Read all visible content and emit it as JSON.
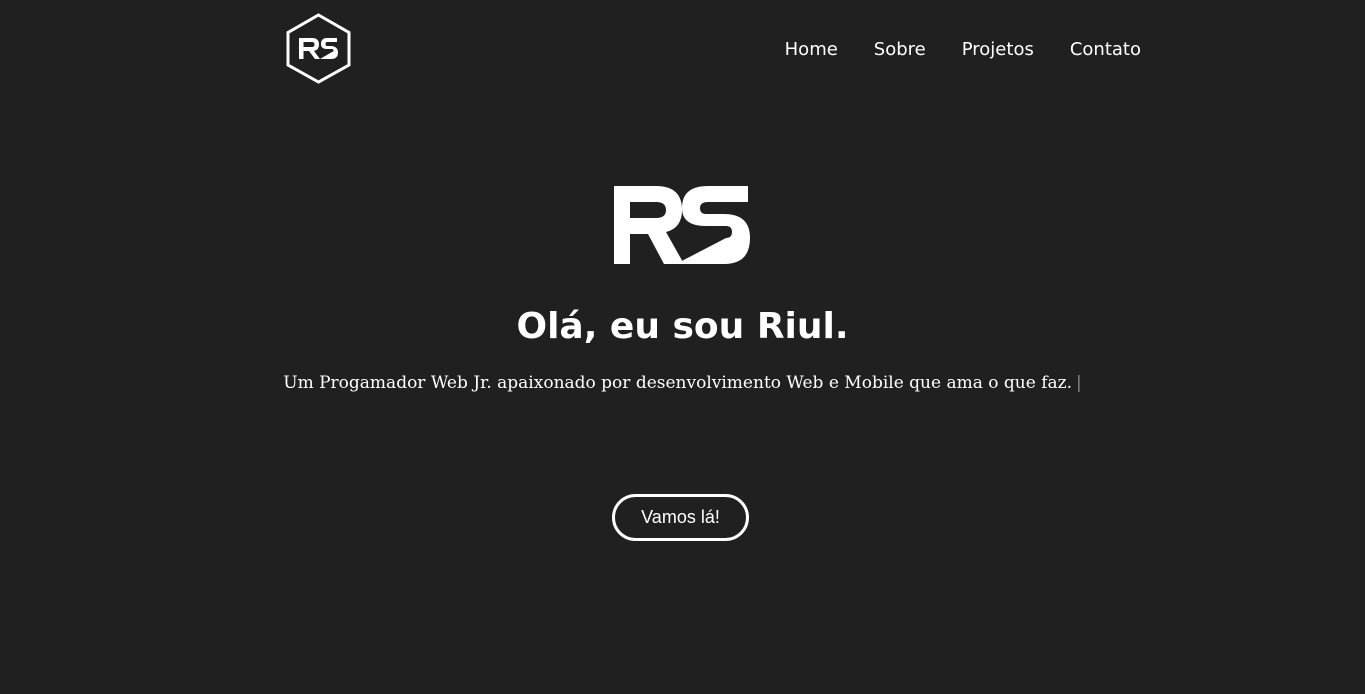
{
  "brand": {
    "logo_text": "RS",
    "logo_icon": "rs-hexagon-logo"
  },
  "nav": {
    "items": [
      {
        "label": "Home"
      },
      {
        "label": "Sobre"
      },
      {
        "label": "Projetos"
      },
      {
        "label": "Contato"
      }
    ]
  },
  "hero": {
    "logo_text": "RS",
    "title": "Olá, eu sou Riul.",
    "subtitle": "Um Progamador Web Jr. apaixonado por desenvolvimento Web e Mobile que ama o que faz.",
    "cursor": "|",
    "cta_label": "Vamos lá!"
  },
  "colors": {
    "background": "#202020",
    "text": "#ffffff",
    "cursor": "#8a8a8a"
  }
}
